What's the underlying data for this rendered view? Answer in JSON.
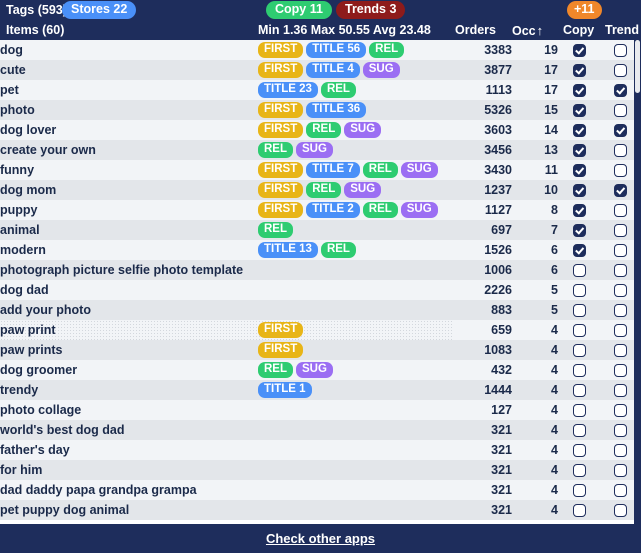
{
  "header": {
    "tags_label": "Tags (593)",
    "stores_badge": "Stores 22",
    "items_label": "Items (60)",
    "copy_badge": "Copy 11",
    "trends_badge": "Trends 3",
    "stats_label": "Min 1.36 Max 50.55 Avg 23.48",
    "orders_label": "Orders",
    "occ_label": "Occ",
    "occ_sort_arrow": "↑",
    "plus_badge": "+11",
    "copy_col_label": "Copy",
    "trend_col_label": "Trend",
    "colors": {
      "background": "#1e2d5c",
      "stores": "#4a90f8",
      "copy": "#2ecc71",
      "trends": "#8e1b1b",
      "plus": "#f0872a"
    }
  },
  "badge_colors": {
    "FIRST": "#e8b517",
    "TITLE": "#4a90f8",
    "REL": "#2ecc71",
    "SUG": "#9b6ef3"
  },
  "rows": [
    {
      "name": "dog",
      "badges": [
        {
          "t": "FIRST",
          "k": "first"
        },
        {
          "t": "TITLE 56",
          "k": "title"
        },
        {
          "t": "REL",
          "k": "rel"
        }
      ],
      "orders": "3383",
      "occ": "19",
      "copy": true,
      "trend": false
    },
    {
      "name": "cute",
      "badges": [
        {
          "t": "FIRST",
          "k": "first"
        },
        {
          "t": "TITLE 4",
          "k": "title"
        },
        {
          "t": "SUG",
          "k": "sug"
        }
      ],
      "orders": "3877",
      "occ": "17",
      "copy": true,
      "trend": false
    },
    {
      "name": "pet",
      "badges": [
        {
          "t": "TITLE 23",
          "k": "title"
        },
        {
          "t": "REL",
          "k": "rel"
        }
      ],
      "orders": "1113",
      "occ": "17",
      "copy": true,
      "trend": true
    },
    {
      "name": "photo",
      "badges": [
        {
          "t": "FIRST",
          "k": "first"
        },
        {
          "t": "TITLE 36",
          "k": "title"
        }
      ],
      "orders": "5326",
      "occ": "15",
      "copy": true,
      "trend": false
    },
    {
      "name": "dog lover",
      "badges": [
        {
          "t": "FIRST",
          "k": "first"
        },
        {
          "t": "REL",
          "k": "rel"
        },
        {
          "t": "SUG",
          "k": "sug"
        }
      ],
      "orders": "3603",
      "occ": "14",
      "copy": true,
      "trend": true
    },
    {
      "name": "create your own",
      "badges": [
        {
          "t": "REL",
          "k": "rel"
        },
        {
          "t": "SUG",
          "k": "sug"
        }
      ],
      "orders": "3456",
      "occ": "13",
      "copy": true,
      "trend": false
    },
    {
      "name": "funny",
      "badges": [
        {
          "t": "FIRST",
          "k": "first"
        },
        {
          "t": "TITLE 7",
          "k": "title"
        },
        {
          "t": "REL",
          "k": "rel"
        },
        {
          "t": "SUG",
          "k": "sug"
        }
      ],
      "orders": "3430",
      "occ": "11",
      "copy": true,
      "trend": false
    },
    {
      "name": "dog mom",
      "badges": [
        {
          "t": "FIRST",
          "k": "first"
        },
        {
          "t": "REL",
          "k": "rel"
        },
        {
          "t": "SUG",
          "k": "sug"
        }
      ],
      "orders": "1237",
      "occ": "10",
      "copy": true,
      "trend": true
    },
    {
      "name": "puppy",
      "badges": [
        {
          "t": "FIRST",
          "k": "first"
        },
        {
          "t": "TITLE 2",
          "k": "title"
        },
        {
          "t": "REL",
          "k": "rel"
        },
        {
          "t": "SUG",
          "k": "sug"
        }
      ],
      "orders": "1127",
      "occ": "8",
      "copy": true,
      "trend": false
    },
    {
      "name": "animal",
      "badges": [
        {
          "t": "REL",
          "k": "rel"
        }
      ],
      "orders": "697",
      "occ": "7",
      "copy": true,
      "trend": false
    },
    {
      "name": "modern",
      "badges": [
        {
          "t": "TITLE 13",
          "k": "title"
        },
        {
          "t": "REL",
          "k": "rel"
        }
      ],
      "orders": "1526",
      "occ": "6",
      "copy": true,
      "trend": false
    },
    {
      "name": "photograph picture selfie photo template",
      "badges": [],
      "orders": "1006",
      "occ": "6",
      "copy": false,
      "trend": false
    },
    {
      "name": "dog dad",
      "badges": [],
      "orders": "2226",
      "occ": "5",
      "copy": false,
      "trend": false
    },
    {
      "name": "add your photo",
      "badges": [],
      "orders": "883",
      "occ": "5",
      "copy": false,
      "trend": false
    },
    {
      "name": "paw print",
      "badges": [
        {
          "t": "FIRST",
          "k": "first"
        }
      ],
      "orders": "659",
      "occ": "4",
      "copy": false,
      "trend": false,
      "dotted": true
    },
    {
      "name": "paw prints",
      "badges": [
        {
          "t": "FIRST",
          "k": "first"
        }
      ],
      "orders": "1083",
      "occ": "4",
      "copy": false,
      "trend": false
    },
    {
      "name": "dog groomer",
      "badges": [
        {
          "t": "REL",
          "k": "rel"
        },
        {
          "t": "SUG",
          "k": "sug"
        }
      ],
      "orders": "432",
      "occ": "4",
      "copy": false,
      "trend": false
    },
    {
      "name": "trendy",
      "badges": [
        {
          "t": "TITLE 1",
          "k": "title"
        }
      ],
      "orders": "1444",
      "occ": "4",
      "copy": false,
      "trend": false
    },
    {
      "name": "photo collage",
      "badges": [],
      "orders": "127",
      "occ": "4",
      "copy": false,
      "trend": false
    },
    {
      "name": "world's best dog dad",
      "badges": [],
      "orders": "321",
      "occ": "4",
      "copy": false,
      "trend": false
    },
    {
      "name": "father's day",
      "badges": [],
      "orders": "321",
      "occ": "4",
      "copy": false,
      "trend": false
    },
    {
      "name": "for him",
      "badges": [],
      "orders": "321",
      "occ": "4",
      "copy": false,
      "trend": false
    },
    {
      "name": "dad daddy papa grandpa grampa",
      "badges": [],
      "orders": "321",
      "occ": "4",
      "copy": false,
      "trend": false
    },
    {
      "name": "pet puppy dog animal",
      "badges": [],
      "orders": "321",
      "occ": "4",
      "copy": false,
      "trend": false
    }
  ],
  "footer": {
    "link_label": "Check other apps"
  }
}
